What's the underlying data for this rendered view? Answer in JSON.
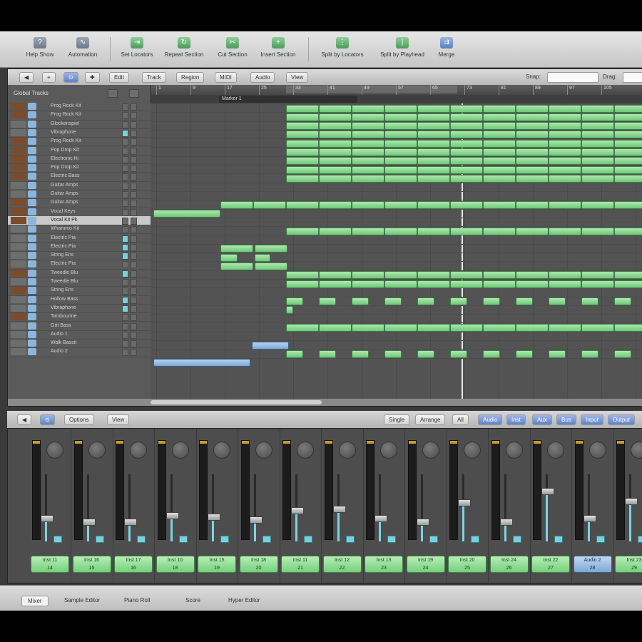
{
  "toolbar": {
    "buttons": [
      {
        "label": "Help Show",
        "icon": "help-icon"
      },
      {
        "label": "Automation",
        "icon": "automation-icon"
      },
      {
        "label": "Set Locators",
        "icon": "locators-icon"
      },
      {
        "label": "Repeat Section",
        "icon": "repeat-icon"
      },
      {
        "label": "Cut Section",
        "icon": "cut-section-icon"
      },
      {
        "label": "Insert Section",
        "icon": "insert-section-icon"
      },
      {
        "label": "Split by Locators",
        "icon": "split-locators-icon"
      },
      {
        "label": "Split by Playhead",
        "icon": "split-playhead-icon"
      },
      {
        "label": "Merge",
        "icon": "merge-icon"
      }
    ]
  },
  "arrange": {
    "menus": [
      "Edit",
      "Track",
      "Region",
      "MIDI",
      "Audio",
      "View"
    ],
    "snap_label": "Snap:",
    "drag_label": "Drag:",
    "global_tracks_label": "Global Tracks",
    "marker_label": "Marker 1",
    "bar_numbers": [
      "1",
      "9",
      "17",
      "25",
      "33",
      "41",
      "49",
      "57",
      "65",
      "73",
      "81",
      "89",
      "97",
      "105"
    ],
    "tracks": [
      "Prog Rock Kit",
      "Prog Rock Kit",
      "Glockenspiel",
      "Vibraphone",
      "Prog Rock Kit",
      "Pop Drop Kit",
      "Electronic Hi",
      "Pop Drop Kit",
      "Electric Bass",
      "Guitar Amps",
      "Guitar Amps",
      "Guitar Amps",
      "Vocal Keys",
      "Vocal Kit Pk",
      "Whammo Kit",
      "Electric Pia",
      "Electric Pia",
      "String Ens",
      "Electric Pia",
      "Tweedle Blu",
      "Tweedle Blu",
      "String Ens",
      "Hollow Bass",
      "Vibraphone",
      "Tambourine",
      "Grit Bass",
      "Audio 1",
      "Walk Bassit",
      "Audio 2"
    ]
  },
  "mixer": {
    "view_menu": "Options",
    "view_menu2": "View",
    "mode_buttons": [
      "Single",
      "Arrange",
      "All"
    ],
    "filter_buttons": [
      "Audio",
      "Inst",
      "Aux",
      "Bus",
      "Input",
      "Output"
    ],
    "strips": [
      {
        "name": "Inst 11",
        "num": "14",
        "level": 0.35
      },
      {
        "name": "Inst 16",
        "num": "15",
        "level": 0.3
      },
      {
        "name": "Inst 17",
        "num": "16",
        "level": 0.3
      },
      {
        "name": "Inst 10",
        "num": "18",
        "level": 0.4
      },
      {
        "name": "Inst 15",
        "num": "19",
        "level": 0.38
      },
      {
        "name": "Inst 18",
        "num": "20",
        "level": 0.33
      },
      {
        "name": "Inst 11",
        "num": "21",
        "level": 0.48
      },
      {
        "name": "Inst 12",
        "num": "22",
        "level": 0.5
      },
      {
        "name": "Inst 13",
        "num": "23",
        "level": 0.35
      },
      {
        "name": "Inst 19",
        "num": "24",
        "level": 0.3
      },
      {
        "name": "Inst 20",
        "num": "25",
        "level": 0.6
      },
      {
        "name": "Inst 24",
        "num": "26",
        "level": 0.3
      },
      {
        "name": "Inst 22",
        "num": "27",
        "level": 0.78
      },
      {
        "name": "Audio 2",
        "num": "28",
        "level": 0.35,
        "audio": true
      },
      {
        "name": "Inst 23",
        "num": "29",
        "level": 0.62
      }
    ]
  },
  "tabs": [
    "Mixer",
    "Sample Editor",
    "Piano Roll",
    "Score",
    "Hyper Editor"
  ]
}
